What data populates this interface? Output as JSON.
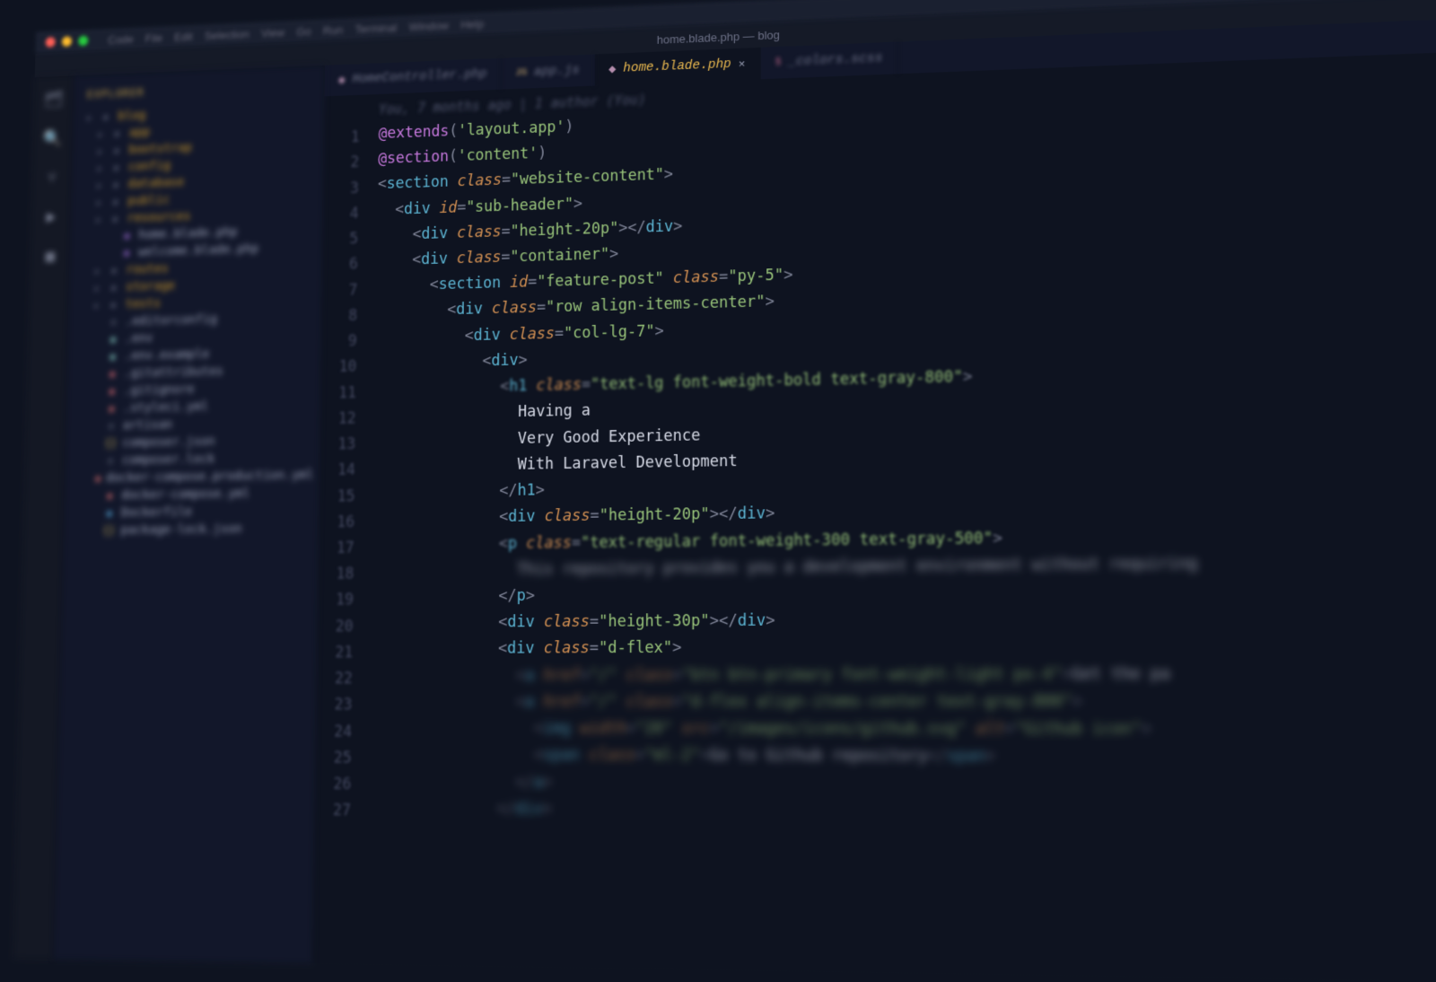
{
  "menubar": {
    "items": [
      "Code",
      "File",
      "Edit",
      "Selection",
      "View",
      "Go",
      "Run",
      "Terminal",
      "Window",
      "Help"
    ]
  },
  "titlebar": "home.blade.php — blog",
  "explorer": {
    "header": "EXPLORER",
    "root": "blog",
    "items": [
      {
        "depth": 0,
        "kind": "folder",
        "label": "blog"
      },
      {
        "depth": 1,
        "kind": "folder",
        "label": "app"
      },
      {
        "depth": 1,
        "kind": "folder",
        "label": "bootstrap"
      },
      {
        "depth": 1,
        "kind": "folder",
        "label": "config"
      },
      {
        "depth": 1,
        "kind": "folder",
        "label": "database"
      },
      {
        "depth": 1,
        "kind": "folder",
        "label": "public"
      },
      {
        "depth": 1,
        "kind": "folder",
        "label": "resources"
      },
      {
        "depth": 2,
        "kind": "php",
        "label": "home.blade.php"
      },
      {
        "depth": 2,
        "kind": "php",
        "label": "welcome.blade.php"
      },
      {
        "depth": 1,
        "kind": "folder",
        "label": "routes"
      },
      {
        "depth": 1,
        "kind": "folder",
        "label": "storage"
      },
      {
        "depth": 1,
        "kind": "folder",
        "label": "tests"
      },
      {
        "depth": 1,
        "kind": "generic",
        "label": ".editorconfig"
      },
      {
        "depth": 1,
        "kind": "env",
        "label": ".env"
      },
      {
        "depth": 1,
        "kind": "env",
        "label": ".env.example"
      },
      {
        "depth": 1,
        "kind": "git",
        "label": ".gitattributes"
      },
      {
        "depth": 1,
        "kind": "git",
        "label": ".gitignore"
      },
      {
        "depth": 1,
        "kind": "yml",
        "label": ".styleci.yml"
      },
      {
        "depth": 1,
        "kind": "generic",
        "label": "artisan"
      },
      {
        "depth": 1,
        "kind": "json",
        "label": "composer.json"
      },
      {
        "depth": 1,
        "kind": "generic",
        "label": "composer.lock"
      },
      {
        "depth": 1,
        "kind": "yml",
        "label": "docker-compose.production.yml"
      },
      {
        "depth": 1,
        "kind": "yml",
        "label": "docker-compose.yml"
      },
      {
        "depth": 1,
        "kind": "docker",
        "label": "Dockerfile"
      },
      {
        "depth": 1,
        "kind": "json",
        "label": "package-lock.json"
      }
    ]
  },
  "tabs": [
    {
      "icon": "php",
      "label": "HomeController.php",
      "active": false
    },
    {
      "icon": "js",
      "label": "app.js",
      "active": false
    },
    {
      "icon": "php",
      "label": "home.blade.php",
      "active": true
    },
    {
      "icon": "scss",
      "label": "_colors.scss",
      "active": false
    }
  ],
  "blame": "You, 7 months ago | 1 author (You)",
  "code": [
    {
      "kind": "dir",
      "indent": 0,
      "name": "@extends",
      "arg": "'layout.app'"
    },
    {
      "kind": "dir",
      "indent": 0,
      "name": "@section",
      "arg": "'content'"
    },
    {
      "kind": "open",
      "indent": 0,
      "tag": "section",
      "attrs": [
        [
          "class",
          "website-content"
        ]
      ]
    },
    {
      "kind": "open",
      "indent": 1,
      "tag": "div",
      "attrs": [
        [
          "id",
          "sub-header"
        ]
      ]
    },
    {
      "kind": "self",
      "indent": 2,
      "tag": "div",
      "attrs": [
        [
          "class",
          "height-20p"
        ]
      ]
    },
    {
      "kind": "open",
      "indent": 2,
      "tag": "div",
      "attrs": [
        [
          "class",
          "container"
        ]
      ]
    },
    {
      "kind": "open",
      "indent": 3,
      "tag": "section",
      "attrs": [
        [
          "id",
          "feature-post"
        ],
        [
          "class",
          "py-5"
        ]
      ]
    },
    {
      "kind": "open",
      "indent": 4,
      "tag": "div",
      "attrs": [
        [
          "class",
          "row align-items-center"
        ]
      ]
    },
    {
      "kind": "open",
      "indent": 5,
      "tag": "div",
      "attrs": [
        [
          "class",
          "col-lg-7"
        ]
      ]
    },
    {
      "kind": "open",
      "indent": 6,
      "tag": "div",
      "attrs": []
    },
    {
      "kind": "open",
      "indent": 7,
      "tag": "h1",
      "attrs": [
        [
          "class",
          "text-lg font-weight-bold text-gray-800"
        ]
      ],
      "blur": "midblur"
    },
    {
      "kind": "text",
      "indent": 8,
      "text": "Having a"
    },
    {
      "kind": "text",
      "indent": 8,
      "text": "Very Good Experience"
    },
    {
      "kind": "text",
      "indent": 8,
      "text": "With Laravel Development"
    },
    {
      "kind": "close",
      "indent": 7,
      "tag": "h1"
    },
    {
      "kind": "self",
      "indent": 7,
      "tag": "div",
      "attrs": [
        [
          "class",
          "height-20p"
        ]
      ]
    },
    {
      "kind": "open",
      "indent": 7,
      "tag": "p",
      "attrs": [
        [
          "class",
          "text-regular font-weight-300 text-gray-500"
        ]
      ],
      "blur": "midblur"
    },
    {
      "kind": "text",
      "indent": 8,
      "text": "This repository provides you a development environment without requiring",
      "blur": "edge"
    },
    {
      "kind": "close",
      "indent": 7,
      "tag": "p"
    },
    {
      "kind": "self",
      "indent": 7,
      "tag": "div",
      "attrs": [
        [
          "class",
          "height-30p"
        ]
      ]
    },
    {
      "kind": "open",
      "indent": 7,
      "tag": "div",
      "attrs": [
        [
          "class",
          "d-flex"
        ]
      ]
    },
    {
      "kind": "open",
      "indent": 8,
      "tag": "a",
      "attrs": [
        [
          "href",
          "/"
        ],
        [
          "class",
          "btn btn-primary font-weight-light px-4"
        ]
      ],
      "tail": "Get the pa",
      "blur": "edge"
    },
    {
      "kind": "open",
      "indent": 8,
      "tag": "a",
      "attrs": [
        [
          "href",
          "/"
        ],
        [
          "class",
          "d-flex align-items-center text-gray-800"
        ]
      ],
      "blur": "edge"
    },
    {
      "kind": "open",
      "indent": 9,
      "tag": "img",
      "attrs": [
        [
          "width",
          "20"
        ],
        [
          "src",
          "/images/icons/github.svg"
        ],
        [
          "alt",
          "Github icon"
        ]
      ],
      "blur": "edge"
    },
    {
      "kind": "open",
      "indent": 9,
      "tag": "span",
      "attrs": [
        [
          "class",
          "ml-2"
        ]
      ],
      "tail": "Go to Github repository",
      "closeTag": "span",
      "blur": "edge"
    },
    {
      "kind": "close",
      "indent": 8,
      "tag": "a",
      "blur": "edge"
    },
    {
      "kind": "close",
      "indent": 7,
      "tag": "div",
      "blur": "edge"
    }
  ]
}
